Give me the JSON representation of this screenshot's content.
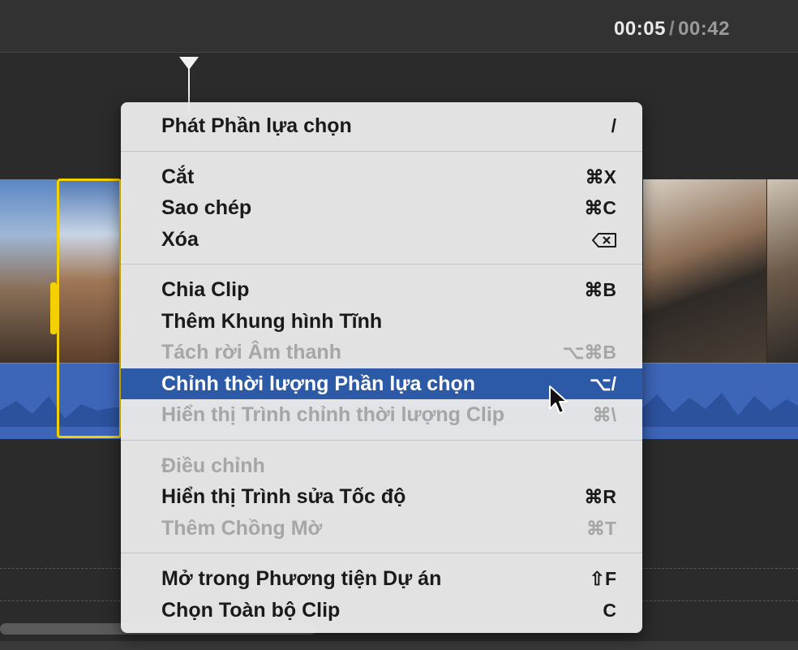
{
  "timecode": {
    "current": "00:05",
    "separator": "/",
    "total": "00:42"
  },
  "context_menu": {
    "groups": [
      [
        {
          "label": "Phát Phần lựa chọn",
          "shortcut": "/",
          "enabled": true
        }
      ],
      [
        {
          "label": "Cắt",
          "shortcut": "⌘X",
          "enabled": true
        },
        {
          "label": "Sao chép",
          "shortcut": "⌘C",
          "enabled": true
        },
        {
          "label": "Xóa",
          "shortcut": "",
          "shortcut_icon": "delete-key-icon",
          "enabled": true
        }
      ],
      [
        {
          "label": "Chia Clip",
          "shortcut": "⌘B",
          "enabled": true
        },
        {
          "label": "Thêm Khung hình Tĩnh",
          "shortcut": "",
          "enabled": true
        },
        {
          "label": "Tách rời Âm thanh",
          "shortcut": "⌥⌘B",
          "enabled": false
        },
        {
          "label": "Chỉnh thời lượng Phần lựa chọn",
          "shortcut": "⌥/",
          "enabled": true,
          "highlighted": true
        },
        {
          "label": "Hiển thị Trình chỉnh thời lượng Clip",
          "shortcut": "⌘\\",
          "enabled": false
        }
      ],
      [
        {
          "label": "Điều chỉnh",
          "shortcut": "",
          "enabled": false
        },
        {
          "label": "Hiển thị Trình sửa Tốc độ",
          "shortcut": "⌘R",
          "enabled": true
        },
        {
          "label": "Thêm Chồng Mờ",
          "shortcut": "⌘T",
          "enabled": false
        }
      ],
      [
        {
          "label": "Mở trong Phương tiện Dự án",
          "shortcut": "⇧F",
          "enabled": true
        },
        {
          "label": "Chọn Toàn bộ Clip",
          "shortcut": "C",
          "enabled": true
        }
      ]
    ]
  },
  "colors": {
    "highlight": "#2d5aa6",
    "selection_border": "#f5d000",
    "audio_track": "#3d65b8"
  }
}
